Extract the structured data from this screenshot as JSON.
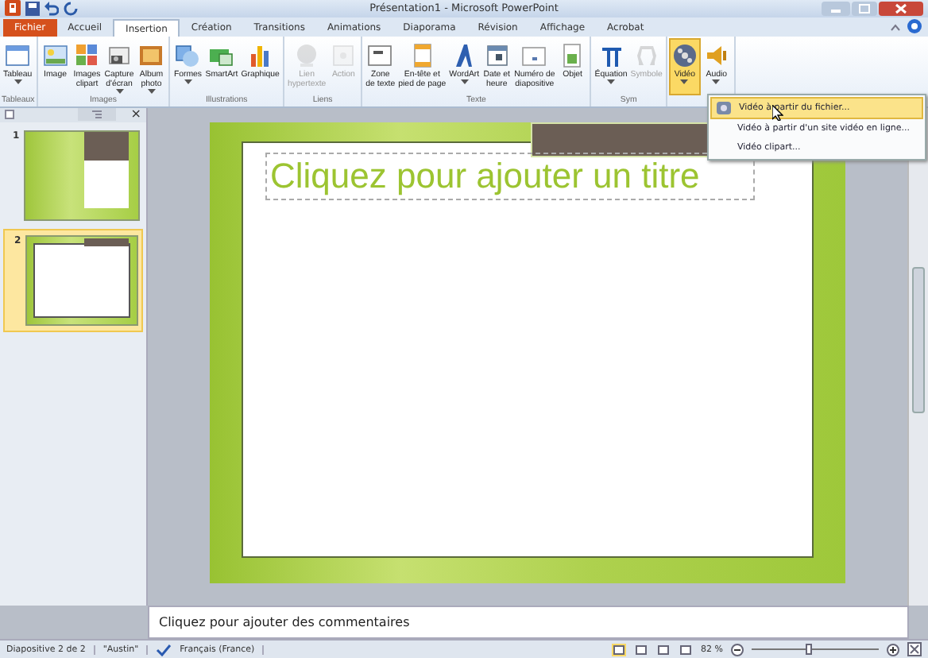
{
  "window": {
    "title": "Présentation1 - Microsoft PowerPoint"
  },
  "tabs": [
    {
      "label": "Fichier",
      "kind": "file",
      "selected": false
    },
    {
      "label": "Accueil",
      "kind": "tab",
      "selected": false
    },
    {
      "label": "Insertion",
      "kind": "tab",
      "selected": true
    },
    {
      "label": "Création",
      "kind": "tab",
      "selected": false
    },
    {
      "label": "Transitions",
      "kind": "tab",
      "selected": false
    },
    {
      "label": "Animations",
      "kind": "tab",
      "selected": false
    },
    {
      "label": "Diaporama",
      "kind": "tab",
      "selected": false
    },
    {
      "label": "Révision",
      "kind": "tab",
      "selected": false
    },
    {
      "label": "Affichage",
      "kind": "tab",
      "selected": false
    },
    {
      "label": "Acrobat",
      "kind": "tab",
      "selected": false
    }
  ],
  "ribbon": {
    "groups": [
      {
        "label": "Tableaux",
        "buttons": [
          {
            "lines": [
              "Tableau"
            ],
            "dropdown": true,
            "disabled": false,
            "selected": false
          }
        ]
      },
      {
        "label": "Images",
        "buttons": [
          {
            "lines": [
              "Image"
            ],
            "dropdown": false,
            "disabled": false,
            "selected": false
          },
          {
            "lines": [
              "Images",
              "clipart"
            ],
            "dropdown": false,
            "disabled": false,
            "selected": false
          },
          {
            "lines": [
              "Capture",
              "d'écran"
            ],
            "dropdown": true,
            "disabled": false,
            "selected": false
          },
          {
            "lines": [
              "Album",
              "photo"
            ],
            "dropdown": true,
            "disabled": false,
            "selected": false
          }
        ]
      },
      {
        "label": "Illustrations",
        "buttons": [
          {
            "lines": [
              "Formes"
            ],
            "dropdown": true,
            "disabled": false,
            "selected": false
          },
          {
            "lines": [
              "SmartArt"
            ],
            "dropdown": false,
            "disabled": false,
            "selected": false
          },
          {
            "lines": [
              "Graphique"
            ],
            "dropdown": false,
            "disabled": false,
            "selected": false
          }
        ]
      },
      {
        "label": "Liens",
        "buttons": [
          {
            "lines": [
              "Lien",
              "hypertexte"
            ],
            "dropdown": false,
            "disabled": true,
            "selected": false
          },
          {
            "lines": [
              "Action"
            ],
            "dropdown": false,
            "disabled": true,
            "selected": false
          }
        ]
      },
      {
        "label": "Texte",
        "buttons": [
          {
            "lines": [
              "Zone",
              "de texte"
            ],
            "dropdown": false,
            "disabled": false,
            "selected": false
          },
          {
            "lines": [
              "En-tête et",
              "pied de page"
            ],
            "dropdown": false,
            "disabled": false,
            "selected": false
          },
          {
            "lines": [
              "WordArt"
            ],
            "dropdown": true,
            "disabled": false,
            "selected": false
          },
          {
            "lines": [
              "Date et",
              "heure"
            ],
            "dropdown": false,
            "disabled": false,
            "selected": false
          },
          {
            "lines": [
              "Numéro de",
              "diapositive"
            ],
            "dropdown": false,
            "disabled": false,
            "selected": false
          },
          {
            "lines": [
              "Objet"
            ],
            "dropdown": false,
            "disabled": false,
            "selected": false
          }
        ]
      },
      {
        "label": "Sym",
        "buttons": [
          {
            "lines": [
              "Équation"
            ],
            "dropdown": true,
            "disabled": false,
            "selected": false
          },
          {
            "lines": [
              "Symbole"
            ],
            "dropdown": false,
            "disabled": true,
            "selected": false
          }
        ]
      },
      {
        "buttons": [
          {
            "lines": [
              "Vidéo"
            ],
            "dropdown": true,
            "disabled": false,
            "selected": true
          },
          {
            "lines": [
              "Audio"
            ],
            "dropdown": true,
            "disabled": false,
            "selected": false
          }
        ]
      }
    ]
  },
  "video_menu": {
    "items": [
      {
        "label": "Vidéo à partir du fichier...",
        "selected": true
      },
      {
        "label": "Vidéo à partir d'un site vidéo en ligne...",
        "selected": false
      },
      {
        "label": "Vidéo clipart...",
        "selected": false
      }
    ]
  },
  "panel": {
    "close": "×",
    "slides": [
      {
        "number": "1",
        "kind": "title",
        "selected": false
      },
      {
        "number": "2",
        "kind": "blank",
        "selected": true
      }
    ]
  },
  "slide": {
    "title_placeholder": "Cliquez pour ajouter un titre"
  },
  "notes": {
    "placeholder": "Cliquez pour ajouter des commentaires"
  },
  "status_bar": {
    "slide": "Diapositive 2 de 2",
    "theme": "\"Austin\"",
    "language": "Français (France)",
    "views": [
      {
        "selected": true
      },
      {
        "selected": false
      },
      {
        "selected": false
      },
      {
        "selected": false
      }
    ],
    "zoom": "82 %",
    "zoom_slider": {
      "level": 0.45
    }
  }
}
